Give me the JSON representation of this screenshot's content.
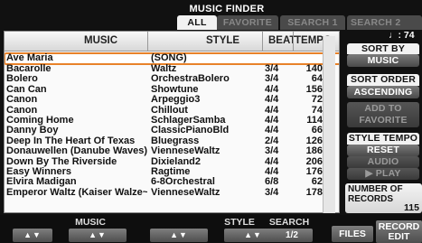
{
  "title": "MUSIC FINDER",
  "tabs": [
    {
      "label": "ALL",
      "active": true
    },
    {
      "label": "FAVORITE",
      "active": false
    },
    {
      "label": "SEARCH 1",
      "active": false
    },
    {
      "label": "SEARCH 2",
      "active": false
    }
  ],
  "tempo_readout": "♩: 74",
  "list": {
    "headers": {
      "music": "MUSIC",
      "style": "STYLE",
      "beat": "BEAT",
      "tempo": "TEMPO"
    },
    "rows": [
      {
        "music": "Ave Maria",
        "style": "(SONG)",
        "beat": "",
        "tempo": "",
        "selected": true
      },
      {
        "music": "Bacarolle",
        "style": "Waltz",
        "beat": "3/4",
        "tempo": "140"
      },
      {
        "music": "Bolero",
        "style": "OrchestraBolero",
        "beat": "3/4",
        "tempo": "64"
      },
      {
        "music": "Can Can",
        "style": "Showtune",
        "beat": "4/4",
        "tempo": "156"
      },
      {
        "music": "Canon",
        "style": "Arpeggio3",
        "beat": "4/4",
        "tempo": "72"
      },
      {
        "music": "Canon",
        "style": "Chillout",
        "beat": "4/4",
        "tempo": "74"
      },
      {
        "music": "Coming Home",
        "style": "SchlagerSamba",
        "beat": "4/4",
        "tempo": "114"
      },
      {
        "music": "Danny Boy",
        "style": "ClassicPianoBld",
        "beat": "4/4",
        "tempo": "66"
      },
      {
        "music": "Deep In The Heart Of Texas",
        "style": "Bluegrass",
        "beat": "2/4",
        "tempo": "126"
      },
      {
        "music": "Donauwellen (Danube Waves)",
        "style": "VienneseWaltz",
        "beat": "3/4",
        "tempo": "186"
      },
      {
        "music": "Down By The Riverside",
        "style": "Dixieland2",
        "beat": "4/4",
        "tempo": "206"
      },
      {
        "music": "Easy Winners",
        "style": "Ragtime",
        "beat": "4/4",
        "tempo": "176"
      },
      {
        "music": "Elvira Madigan",
        "style": "6-8Orchestral",
        "beat": "6/8",
        "tempo": "62"
      },
      {
        "music": "Emperor Waltz (Kaiser Walze~",
        "style": "VienneseWaltz",
        "beat": "3/4",
        "tempo": "178"
      }
    ]
  },
  "right_panel": {
    "sort_by_label": "SORT BY",
    "sort_by_value": "MUSIC",
    "sort_order_label": "SORT ORDER",
    "sort_order_value": "ASCENDING",
    "add_favorite_line1": "ADD TO",
    "add_favorite_line2": "FAVORITE",
    "style_tempo_label": "STYLE TEMPO",
    "reset_label": "RESET",
    "audio_label": "AUDIO",
    "play_label": "▶ PLAY",
    "records_label_line1": "NUMBER OF",
    "records_label_line2": "RECORDS",
    "records_value": "115"
  },
  "bottom_bar": {
    "music_label": "MUSIC",
    "style_label": "STYLE",
    "search_label": "SEARCH",
    "arrow_glyph": "▲▼",
    "search_page": "1/2",
    "files_label": "FILES",
    "record_edit_line1": "RECORD",
    "record_edit_line2": "EDIT"
  }
}
